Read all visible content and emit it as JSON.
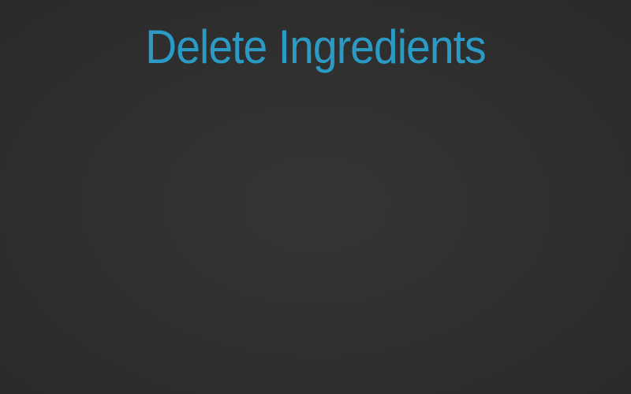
{
  "page": {
    "title": "Delete Ingredients"
  },
  "colors": {
    "title": "#2b9bc6",
    "background_center": "#353535",
    "background_edge": "#2a2a2a"
  }
}
